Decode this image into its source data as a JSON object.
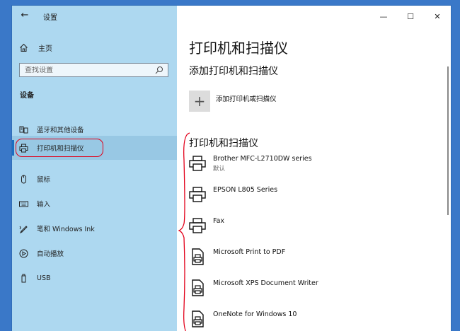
{
  "window": {
    "app_title": "设置",
    "back_icon": "back-arrow-icon",
    "controls": {
      "minimize": "—",
      "maximize": "☐",
      "close": "✕"
    }
  },
  "sidebar": {
    "home_label": "主页",
    "search_placeholder": "查找设置",
    "section_label": "设备",
    "items": [
      {
        "label": "蓝牙和其他设备",
        "icon": "bluetooth-devices-icon",
        "active": false
      },
      {
        "label": "打印机和扫描仪",
        "icon": "printer-icon",
        "active": true
      },
      {
        "label": "鼠标",
        "icon": "mouse-icon",
        "active": false
      },
      {
        "label": "输入",
        "icon": "keyboard-icon",
        "active": false
      },
      {
        "label": "笔和 Windows Ink",
        "icon": "pen-icon",
        "active": false
      },
      {
        "label": "自动播放",
        "icon": "autoplay-icon",
        "active": false
      },
      {
        "label": "USB",
        "icon": "usb-icon",
        "active": false
      }
    ]
  },
  "main": {
    "page_title": "打印机和扫描仪",
    "add_section_title": "添加打印机和扫描仪",
    "add_button_label": "添加打印机或扫描仪",
    "list_title": "打印机和扫描仪",
    "devices": [
      {
        "name": "Brother MFC-L2710DW series",
        "status": "默认",
        "icon": "printer-icon"
      },
      {
        "name": "EPSON L805 Series",
        "status": "",
        "icon": "printer-icon"
      },
      {
        "name": "Fax",
        "status": "",
        "icon": "printer-icon"
      },
      {
        "name": "Microsoft Print to PDF",
        "status": "",
        "icon": "document-printer-icon"
      },
      {
        "name": "Microsoft XPS Document Writer",
        "status": "",
        "icon": "document-printer-icon"
      },
      {
        "name": "OneNote for Windows 10",
        "status": "",
        "icon": "document-printer-icon"
      }
    ]
  },
  "annotation_color": "#e2001a",
  "accent_color": "#1b6ec2"
}
